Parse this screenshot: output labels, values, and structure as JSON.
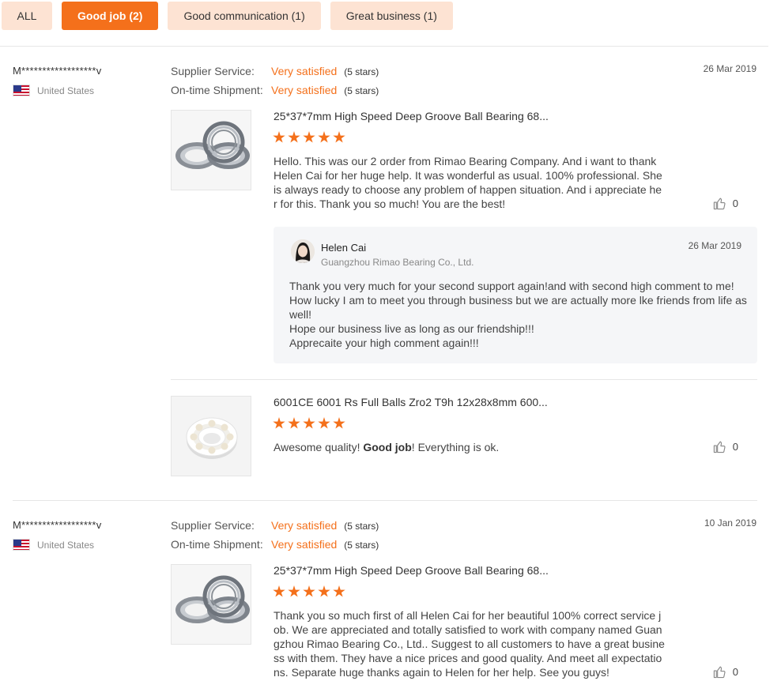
{
  "tabs": [
    {
      "label": "ALL",
      "active": false
    },
    {
      "label": "Good job (2)",
      "active": true
    },
    {
      "label": "Good communication (1)",
      "active": false
    },
    {
      "label": "Great business (1)",
      "active": false
    }
  ],
  "reviews": [
    {
      "buyer": "M******************v",
      "country": "United States",
      "supplier_service_label": "Supplier Service:",
      "supplier_service_value": "Very satisfied",
      "supplier_service_stars": "(5 stars)",
      "shipment_label": "On-time Shipment:",
      "shipment_value": "Very satisfied",
      "shipment_stars": "(5 stars)",
      "date": "26 Mar 2019",
      "items": [
        {
          "title": "25*37*7mm High Speed Deep Groove Ball Bearing 68...",
          "rating": 5,
          "comment": "Hello. This was our 2 order from Rimao Bearing Company. And i want to thank Helen Cai for her huge help. It was wonderful as usual. 100% professional. She is always ready to choose any problem of happen situation. And i appreciate her for this. Thank you so much! You are the best!",
          "likes": "0",
          "reply": {
            "name": "Helen Cai",
            "company": "Guangzhou Rimao Bearing Co., Ltd.",
            "date": "26 Mar 2019",
            "lines": [
              "Thank you very much for your second support again!and with second high comment to me!",
              "How lucky I am to meet you through business but we are actually more lke friends from life as well!",
              "Hope our business live as long as our friendship!!!",
              "Apprecaite your high comment again!!!"
            ]
          }
        },
        {
          "title": "6001CE 6001 Rs Full Balls Zro2 T9h 12x28x8mm 600...",
          "rating": 5,
          "comment_before": "Awesome quality! ",
          "comment_bold": "Good job",
          "comment_after": "! Everything is ok.",
          "likes": "0"
        }
      ]
    },
    {
      "buyer": "M******************v",
      "country": "United States",
      "supplier_service_label": "Supplier Service:",
      "supplier_service_value": "Very satisfied",
      "supplier_service_stars": "(5 stars)",
      "shipment_label": "On-time Shipment:",
      "shipment_value": "Very satisfied",
      "shipment_stars": "(5 stars)",
      "date": "10 Jan 2019",
      "items": [
        {
          "title": "25*37*7mm High Speed Deep Groove Ball Bearing 68...",
          "rating": 5,
          "comment": "Thank you so much first of all Helen Cai for her beautiful 100% correct service job. We are appreciated and totally satisfied to work with company named Guangzhou Rimao Bearing Co., Ltd.. Suggest to all customers to have a great business with them. They have a nice prices and good quality. And meet all expectations. Separate huge thanks again to Helen for her help. See you guys!",
          "likes": "0"
        }
      ]
    }
  ],
  "colors": {
    "accent": "#f4701b",
    "tab_bg": "#fde3d3",
    "reply_bg": "#f5f6f8"
  },
  "icons": {
    "like": "thumbs-up-icon",
    "flag": "us-flag-icon"
  }
}
